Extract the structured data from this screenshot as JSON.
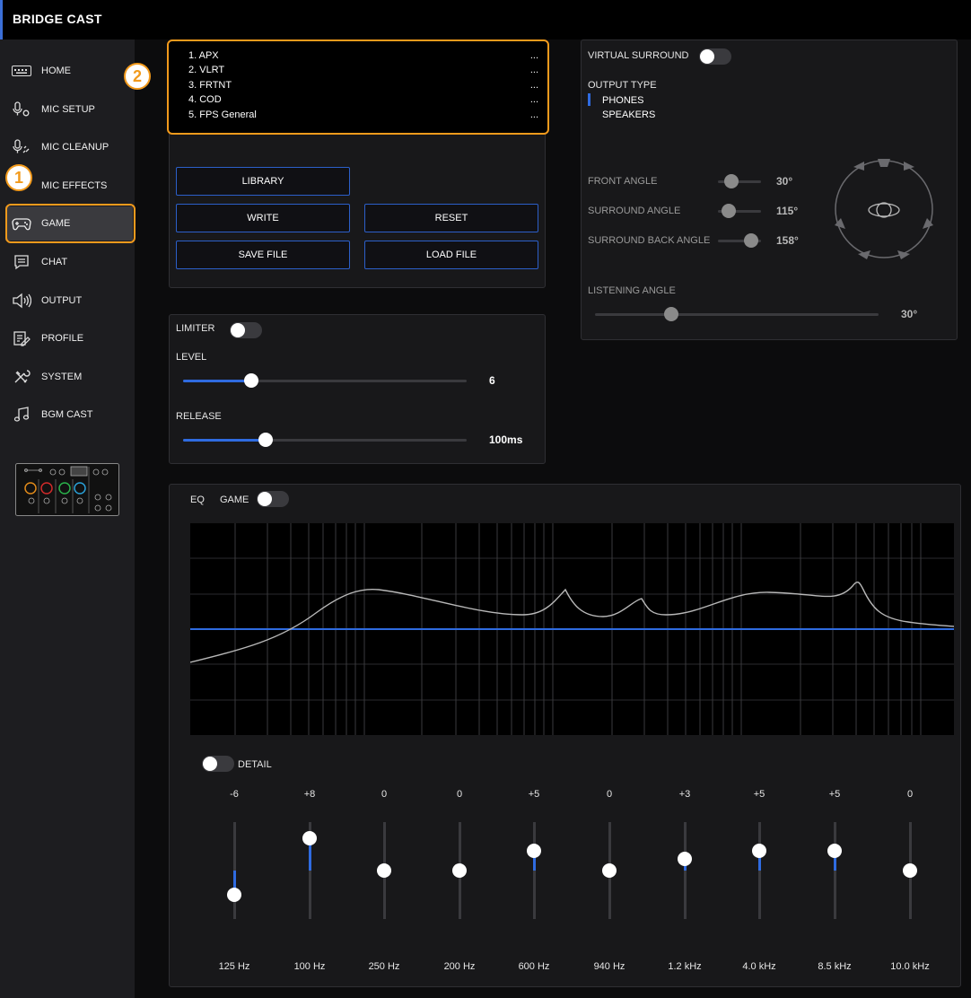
{
  "app": {
    "title": "BRIDGE CAST"
  },
  "sidebar": {
    "items": [
      {
        "label": "HOME",
        "icon": "keyboard-icon"
      },
      {
        "label": "MIC SETUP",
        "icon": "mic-settings-icon"
      },
      {
        "label": "MIC CLEANUP",
        "icon": "mic-cleanup-icon"
      },
      {
        "label": "MIC EFFECTS",
        "icon": "mic-effects-icon"
      },
      {
        "label": "GAME",
        "icon": "gamepad-icon",
        "active": true
      },
      {
        "label": "CHAT",
        "icon": "chat-icon"
      },
      {
        "label": "OUTPUT",
        "icon": "speaker-icon"
      },
      {
        "label": "PROFILE",
        "icon": "profile-icon"
      },
      {
        "label": "SYSTEM",
        "icon": "tools-icon"
      },
      {
        "label": "BGM CAST",
        "icon": "music-note-icon"
      }
    ]
  },
  "callouts": {
    "one": "1",
    "two": "2"
  },
  "presets": [
    {
      "name": "1. APX",
      "more": "..."
    },
    {
      "name": "2. VLRT",
      "more": "..."
    },
    {
      "name": "3. FRTNT",
      "more": "..."
    },
    {
      "name": "4. COD",
      "more": "..."
    },
    {
      "name": "5. FPS General",
      "more": "..."
    }
  ],
  "buttons": {
    "library": "LIBRARY",
    "write": "WRITE",
    "reset": "RESET",
    "save_file": "SAVE FILE",
    "load_file": "LOAD FILE"
  },
  "limiter": {
    "label": "LIMITER",
    "enabled": false,
    "level": {
      "label": "LEVEL",
      "value": "6",
      "fraction": 0.24
    },
    "release": {
      "label": "RELEASE",
      "value": "100ms",
      "fraction": 0.29
    }
  },
  "surround": {
    "label": "VIRTUAL SURROUND",
    "enabled": false,
    "output_type_label": "OUTPUT TYPE",
    "options": [
      "PHONES",
      "SPEAKERS"
    ],
    "selected": "PHONES",
    "front_angle": {
      "label": "FRONT ANGLE",
      "value": "30°"
    },
    "surround_angle": {
      "label": "SURROUND ANGLE",
      "value": "115°"
    },
    "surround_back_angle": {
      "label": "SURROUND BACK ANGLE",
      "value": "158°"
    },
    "listening_angle": {
      "label": "LISTENING ANGLE",
      "value": "30°",
      "fraction": 0.27
    }
  },
  "eq": {
    "label": "EQ",
    "channel": "GAME",
    "enabled": true,
    "detail_label": "DETAIL",
    "detail_enabled": false,
    "bands": [
      {
        "gain": "-6",
        "gain_num": -6,
        "freq": "125 Hz"
      },
      {
        "gain": "+8",
        "gain_num": 8,
        "freq": "100 Hz"
      },
      {
        "gain": "0",
        "gain_num": 0,
        "freq": "250 Hz"
      },
      {
        "gain": "0",
        "gain_num": 0,
        "freq": "200 Hz"
      },
      {
        "gain": "+5",
        "gain_num": 5,
        "freq": "600 Hz"
      },
      {
        "gain": "0",
        "gain_num": 0,
        "freq": "940 Hz"
      },
      {
        "gain": "+3",
        "gain_num": 3,
        "freq": "1.2 kHz"
      },
      {
        "gain": "+5",
        "gain_num": 5,
        "freq": "4.0 kHz"
      },
      {
        "gain": "+5",
        "gain_num": 5,
        "freq": "8.5 kHz"
      },
      {
        "gain": "0",
        "gain_num": 0,
        "freq": "10.0 kHz"
      }
    ]
  },
  "colors": {
    "accent": "#2f6be0",
    "callout": "#f29a1c"
  }
}
